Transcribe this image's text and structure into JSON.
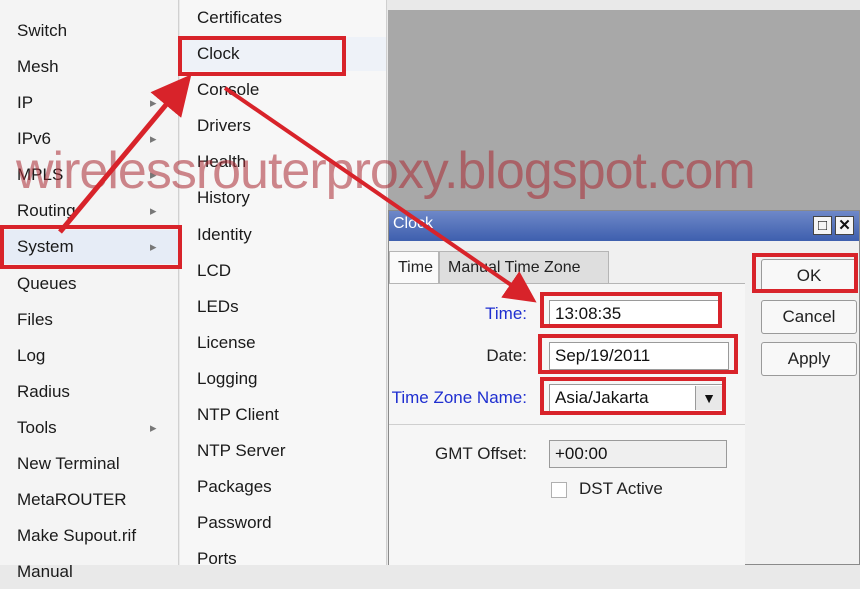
{
  "main_menu": {
    "items": [
      {
        "label": "Switch",
        "has_submenu": false
      },
      {
        "label": "Mesh",
        "has_submenu": false
      },
      {
        "label": "IP",
        "has_submenu": true
      },
      {
        "label": "IPv6",
        "has_submenu": true
      },
      {
        "label": "MPLS",
        "has_submenu": true
      },
      {
        "label": "Routing",
        "has_submenu": true
      },
      {
        "label": "System",
        "has_submenu": true
      },
      {
        "label": "Queues",
        "has_submenu": false
      },
      {
        "label": "Files",
        "has_submenu": false
      },
      {
        "label": "Log",
        "has_submenu": false
      },
      {
        "label": "Radius",
        "has_submenu": false
      },
      {
        "label": "Tools",
        "has_submenu": true
      },
      {
        "label": "New Terminal",
        "has_submenu": false
      },
      {
        "label": "MetaROUTER",
        "has_submenu": false
      },
      {
        "label": "Make Supout.rif",
        "has_submenu": false
      },
      {
        "label": "Manual",
        "has_submenu": false
      }
    ],
    "submenu_arrow": "▸"
  },
  "sub_menu": {
    "items": [
      "Certificates",
      "Clock",
      "Console",
      "Drivers",
      "Health",
      "History",
      "Identity",
      "LCD",
      "LEDs",
      "License",
      "Logging",
      "NTP Client",
      "NTP Server",
      "Packages",
      "Password",
      "Ports"
    ]
  },
  "clock_window": {
    "title": "Clock",
    "restore_glyph": "□",
    "close_glyph": "✕",
    "tabs": [
      "Time",
      "Manual Time Zone"
    ],
    "fields": {
      "time_label": "Time:",
      "time_value": "13:08:35",
      "date_label": "Date:",
      "date_value": "Sep/19/2011",
      "tz_label": "Time Zone Name:",
      "tz_value": "Asia/Jakarta",
      "tz_dropdown_glyph": "▼",
      "gmt_label": "GMT Offset:",
      "gmt_value": "+00:00",
      "dst_label": "DST Active"
    },
    "buttons": {
      "ok": "OK",
      "cancel": "Cancel",
      "apply": "Apply"
    }
  },
  "watermark": "wirelessrouterproxy.blogspot.com",
  "colors": {
    "annotation_red": "#d8232a",
    "title_bar_blue": "#3e5fae",
    "label_blue": "#1f2fd0"
  }
}
